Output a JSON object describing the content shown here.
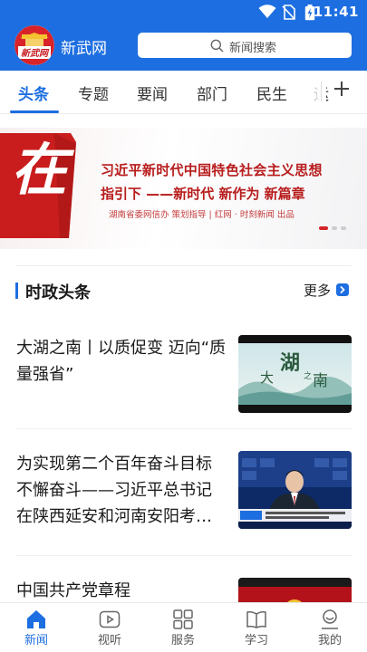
{
  "status_bar": {
    "time": "11:41"
  },
  "header": {
    "logo_text": "新武网",
    "app_title": "新武网",
    "search_placeholder": "新闻搜索"
  },
  "tabs": [
    {
      "label": "头条",
      "active": true
    },
    {
      "label": "专题",
      "active": false
    },
    {
      "label": "要闻",
      "active": false
    },
    {
      "label": "部门",
      "active": false
    },
    {
      "label": "民生",
      "active": false
    },
    {
      "label": "运",
      "active": false
    }
  ],
  "banner": {
    "big_char": "在",
    "line1": "习近平新时代中国特色社会主义思想",
    "line2": "指引下 ——新时代 新作为 新篇章",
    "line3": "湖南省委网信办 策划指导 | 红网 · 时刻新闻 出品",
    "slides": 3,
    "active_slide": 0
  },
  "section": {
    "title": "时政头条",
    "more_label": "更多"
  },
  "news": [
    {
      "title": "大湖之南丨以质促变 迈向“质量强省”",
      "thumb_text": "大湖之南"
    },
    {
      "title": "为实现第二个百年奋斗目标不懈奋斗——习近平总书记在陕西延安和河南安阳考…",
      "thumb_text": ""
    },
    {
      "title": "中国共产党章程",
      "thumb_text": ""
    }
  ],
  "bottom_nav": [
    {
      "label": "新闻",
      "icon": "home-icon",
      "active": true
    },
    {
      "label": "视听",
      "icon": "play-icon",
      "active": false
    },
    {
      "label": "服务",
      "icon": "grid-icon",
      "active": false
    },
    {
      "label": "学习",
      "icon": "book-icon",
      "active": false
    },
    {
      "label": "我的",
      "icon": "profile-icon",
      "active": false
    }
  ],
  "colors": {
    "accent": "#1d6ee0",
    "banner_red": "#b81c1c"
  }
}
